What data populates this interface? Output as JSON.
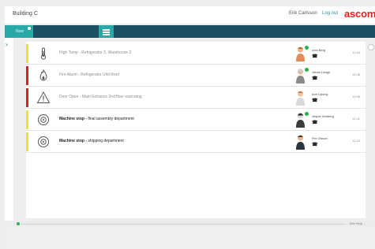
{
  "header": {
    "title": "Building C",
    "user": "Erik Carlsson",
    "logout": "Log out",
    "brand": "ascom"
  },
  "nav": {
    "left_label": "Now",
    "menu_icon": "menu-icon"
  },
  "alarms": [
    {
      "color": "#e7e23a",
      "icon": "thermometer-icon",
      "text": "High Temp - Refrigerator 3, Warehouse 2",
      "emphasis": false,
      "person": "Lina Berg",
      "time": "11:04"
    },
    {
      "color": "#d42027",
      "icon": "fire-icon",
      "text": "Fire Alarm - Refrigerator Unit Roof",
      "emphasis": false,
      "person": "Johan Lange",
      "time": "11:06"
    },
    {
      "color": "#d42027",
      "icon": "warning-icon",
      "text": "Door Open - Main Entrance 2nd floor east wing",
      "emphasis": false,
      "person": "Ann Lyberg",
      "time": "11:06"
    },
    {
      "color": "#e7e23a",
      "icon": "gear-icon",
      "text_bold": "Machine stop -",
      "text_rest": " final assembly department",
      "emphasis": true,
      "person": "Jesper Ahnberg",
      "time": "11:11"
    },
    {
      "color": "#e7e23a",
      "icon": "gear-icon",
      "text_bold": "Machine stop -",
      "text_rest": " shipping department",
      "emphasis": true,
      "person": "Per Olsson",
      "time": "11:13"
    }
  ],
  "phone_icon": "phone-icon",
  "bottom": {
    "status_text": "Info  Help"
  }
}
